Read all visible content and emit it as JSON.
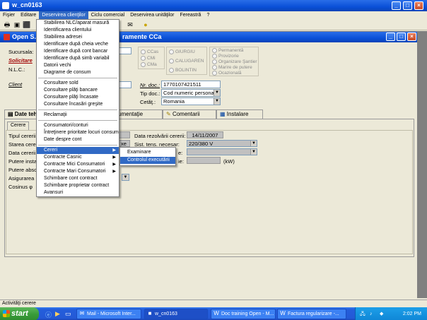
{
  "app": {
    "title": "w_cn0163",
    "inner_title": "Open S.C",
    "inner_title_rest": "ramente CCa"
  },
  "menubar": [
    "Fişier",
    "Editare",
    "Deservirea clienţilor",
    "Ciclu comercial",
    "Deservirea unităţilor",
    "Fereastră",
    "?"
  ],
  "form": {
    "sucursala_label": "Sucursala:",
    "solicitare_label": "Solicitare",
    "nlc_label": "N.L.C.:",
    "client_label": "Client",
    "radio_group1": [
      "CCas",
      "CMi",
      "CMa"
    ],
    "radio_group2": [
      "GIURGIU",
      "CALUGAREN",
      "BOLINTIN"
    ],
    "radio_group3": [
      "Permanentă",
      "Provizorie",
      "Organizare Şantier",
      "Marire de putere",
      "Ocazională"
    ],
    "nr_doc_label": "Nr. doc.:",
    "nr_doc_value": "1770107421511",
    "tip_doc_label": "Tip doc.:",
    "tip_doc_value": "Cod numeric personal",
    "cetat_label": "Cetăţ.:",
    "cetat_value": "Romania"
  },
  "tabs": [
    {
      "label": "Date teh",
      "icon": "document-icon"
    },
    {
      "label": "umentaţie",
      "icon": "folder-icon"
    },
    {
      "label": "Comentarii",
      "icon": "note-icon"
    },
    {
      "label": "Instalare",
      "icon": "grid-icon"
    }
  ],
  "panel": {
    "cerere_tab": "Cerere",
    "left_labels": [
      "Tipul cererii",
      "Starea cere",
      "Data cererii",
      "Putere insta",
      "Putere abso",
      "Asigurarea",
      "Cosinus φ"
    ],
    "grey_frag": "xe",
    "data_rezolvarii_label": "Data rezolvării cererii:",
    "data_rezolvarii_value": "14/11/2007",
    "sist_tens_label": "Sist. tens. necesar:",
    "sist_tens_value": "220/380 V",
    "e_frag": "e:",
    "ie_frag": "ie:",
    "kw_label": "(kW)"
  },
  "dropdown": {
    "items": [
      {
        "label": "Stabilirea NLC/aparat masură",
        "type": "item"
      },
      {
        "label": "Identificarea clientului",
        "type": "item"
      },
      {
        "label": "Stabilirea adresei",
        "type": "item"
      },
      {
        "label": "Identificare după cheia veche",
        "type": "item"
      },
      {
        "label": "Identificare după cont bancar",
        "type": "item"
      },
      {
        "label": "Identificare după simb variabil",
        "type": "item"
      },
      {
        "label": "Datorii vechi",
        "type": "item"
      },
      {
        "label": "Diagrame de consum",
        "type": "item"
      },
      {
        "type": "sep"
      },
      {
        "label": "Consultare sold",
        "type": "item"
      },
      {
        "label": "Consultare plăţi bancare",
        "type": "item"
      },
      {
        "label": "Consultare plăţi încasate",
        "type": "item"
      },
      {
        "label": "Consultare încasări greşite",
        "type": "item"
      },
      {
        "type": "sep"
      },
      {
        "label": "Reclamaţii",
        "type": "item"
      },
      {
        "type": "sep"
      },
      {
        "label": "Consumatori/conturi",
        "type": "item"
      },
      {
        "label": "Întreţinere prioritate locuri consum",
        "type": "item"
      },
      {
        "label": "Date despre cont",
        "type": "item"
      },
      {
        "type": "sep"
      },
      {
        "label": "Cereri",
        "type": "sub",
        "selected": true
      },
      {
        "label": "Contracte Casnic",
        "type": "sub"
      },
      {
        "label": "Contracte Mici Consumatori",
        "type": "sub"
      },
      {
        "label": "Contracte Mari Consumatori",
        "type": "sub"
      },
      {
        "label": "Schimbare cont contract",
        "type": "item"
      },
      {
        "label": "Schimbare proprietar contract",
        "type": "item"
      },
      {
        "label": "Avansuri",
        "type": "item"
      }
    ]
  },
  "submenu": {
    "items": [
      {
        "label": "Examinare",
        "selected": false
      },
      {
        "label": "Controlul executării",
        "selected": true
      }
    ]
  },
  "status_bar": "Activităţi cerere",
  "taskbar": {
    "start": "start",
    "items": [
      {
        "label": "Mail - Microsoft Inter...",
        "icon": "mail-icon",
        "active": false
      },
      {
        "label": "w_cn0163",
        "icon": "app-icon",
        "active": true
      },
      {
        "label": "Doc training Open - M...",
        "icon": "word-icon",
        "active": false
      },
      {
        "label": "Factura regularizare -...",
        "icon": "word-icon",
        "active": false
      }
    ],
    "clock": "2:02 PM"
  },
  "colors": {
    "title_blue": "#0a50d8",
    "menu_highlight": "#316ac5",
    "window_bg": "#ece9d8",
    "taskbar_blue": "#245edb",
    "start_green": "#3a9d3a"
  }
}
